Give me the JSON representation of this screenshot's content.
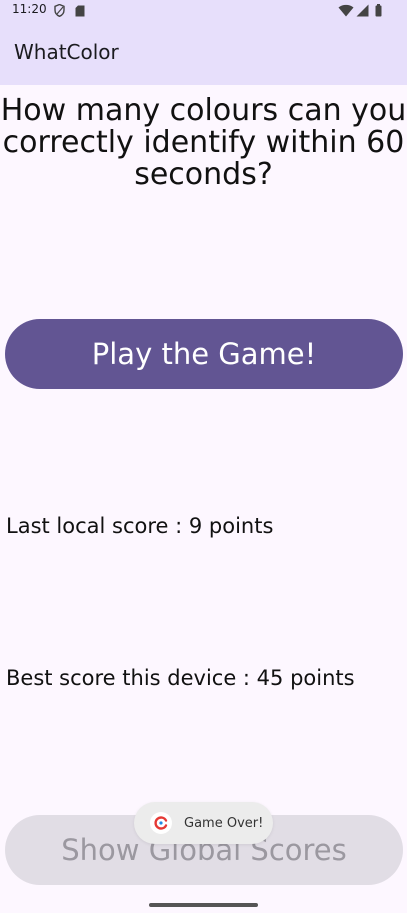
{
  "status_bar": {
    "time": "11:20",
    "icons": [
      "shield-icon",
      "sd-card-icon",
      "wifi-icon",
      "cellular-signal-icon",
      "battery-icon"
    ]
  },
  "app_bar": {
    "title": "WhatColor"
  },
  "main": {
    "question": "How many colours can you correctly identify within 60 seconds?",
    "play_button_label": "Play the Game!",
    "last_score_text": "Last local score : 9 points",
    "best_score_text": "Best score this device : 45 points",
    "global_scores_label": "Show Global Scores"
  },
  "toast": {
    "message": "Game Over!",
    "icon": "app-logo-icon"
  },
  "colors": {
    "app_bar": "#e7dffb",
    "background": "#fdf7ff",
    "primary_button": "#625593",
    "secondary_button": "#e1dde5"
  }
}
